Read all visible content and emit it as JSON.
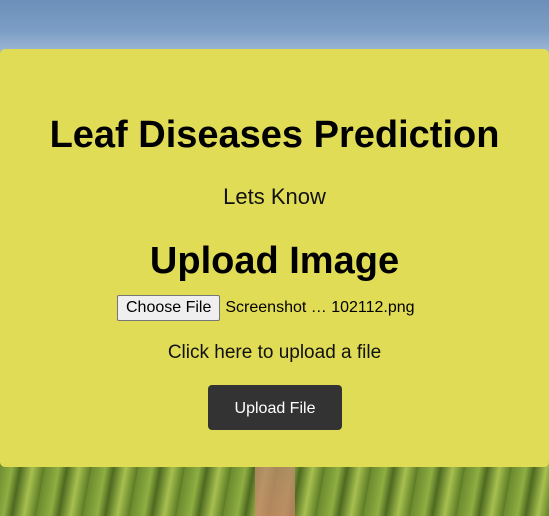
{
  "page": {
    "title": "Leaf Diseases Prediction",
    "subtitle": "Lets Know",
    "upload_heading": "Upload Image"
  },
  "file_input": {
    "button_label": "Choose File",
    "selected_file": "Screenshot … 102112.png"
  },
  "upload_hint": "Click here to upload a file",
  "upload_button_label": "Upload File",
  "colors": {
    "card_background": "#e1dc55",
    "upload_button": "#333333"
  }
}
